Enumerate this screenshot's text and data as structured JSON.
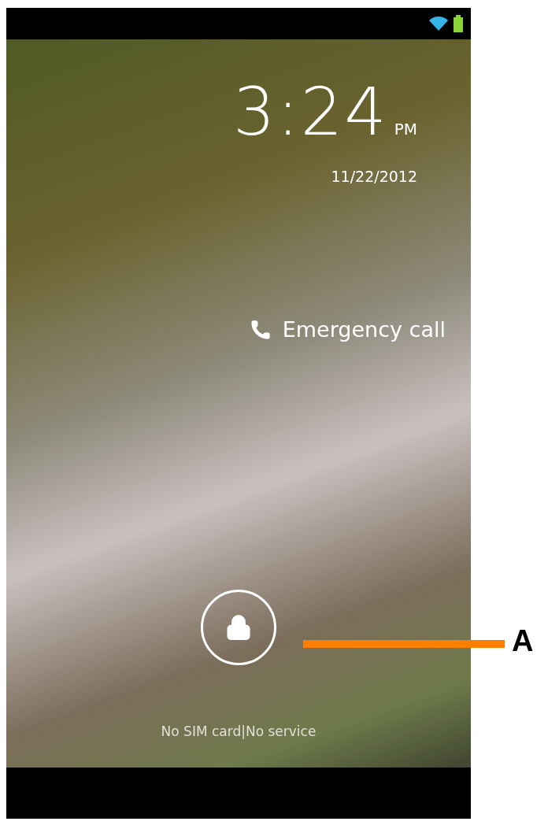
{
  "clock": {
    "time": "3:24",
    "ampm": "PM",
    "date": "11/22/2012"
  },
  "emergency_call": "Emergency call",
  "carrier_text": "No SIM card|No service",
  "callout": {
    "label": "A"
  }
}
